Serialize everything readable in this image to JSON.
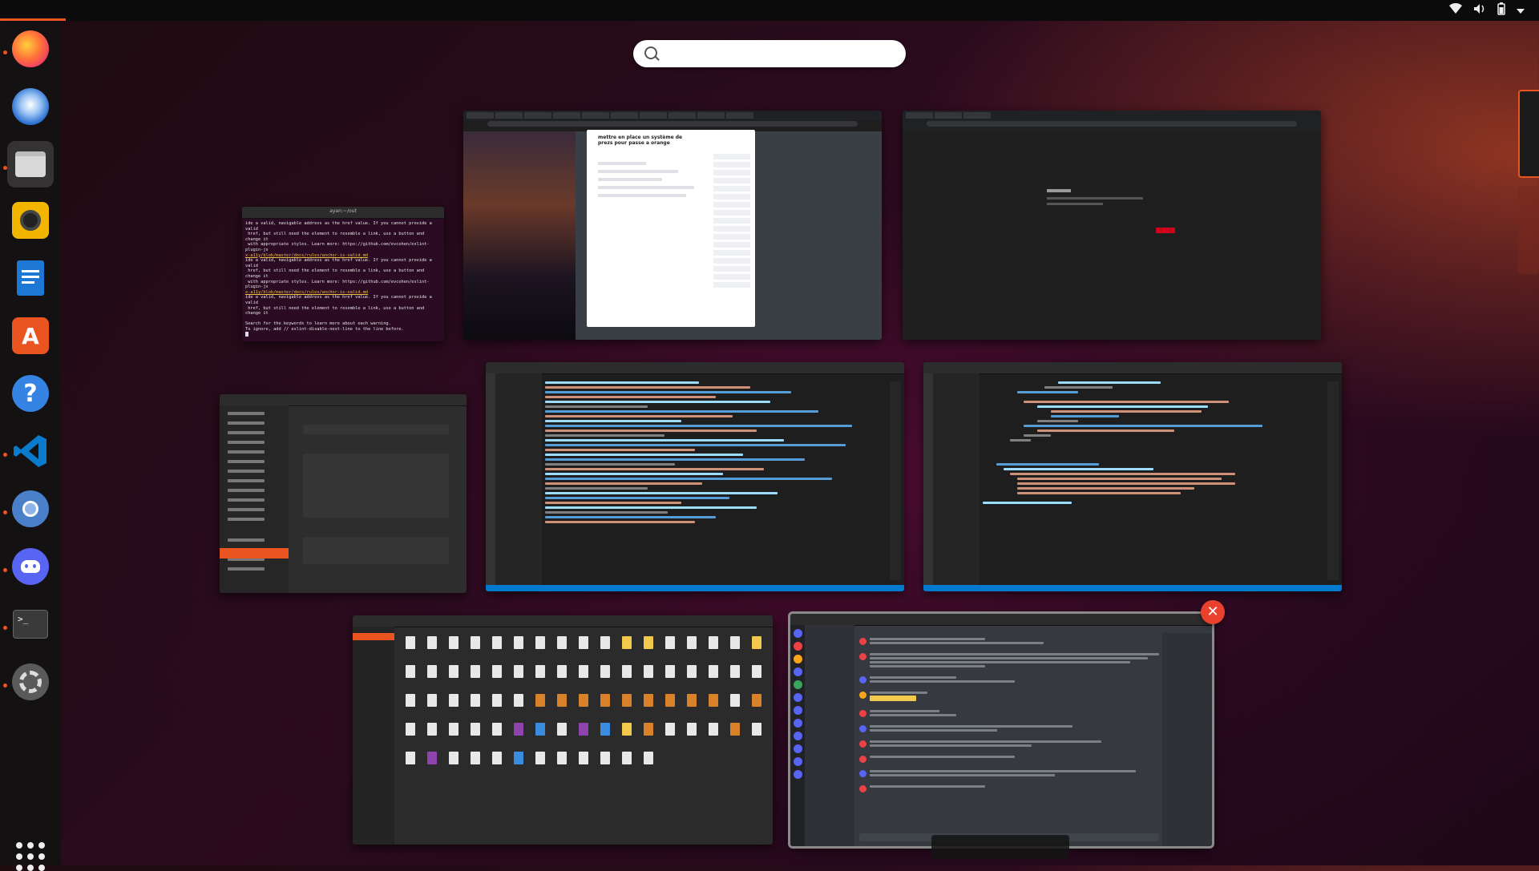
{
  "topbar": {
    "tray_icons": [
      "wifi-icon",
      "volume-icon",
      "battery-icon",
      "menu-arrow-icon"
    ]
  },
  "search": {
    "placeholder": "",
    "value": ""
  },
  "dock": {
    "items": [
      {
        "name": "firefox",
        "color": "#ff7139",
        "running": true
      },
      {
        "name": "thunderbird",
        "color": "#2a6fd0",
        "running": false
      },
      {
        "name": "files",
        "color": "#d9d9d9",
        "running": true
      },
      {
        "name": "rhythmbox",
        "color": "#f2b600",
        "running": false
      },
      {
        "name": "writer",
        "color": "#1c78d4",
        "running": false
      },
      {
        "name": "software",
        "color": "#e95420",
        "running": false
      },
      {
        "name": "help",
        "color": "#3584e4",
        "running": false
      },
      {
        "name": "vscode",
        "color": "#0a7acc",
        "running": true
      },
      {
        "name": "chromium",
        "color": "#4a80c9",
        "running": true
      },
      {
        "name": "discord",
        "color": "#5865f2",
        "running": true
      },
      {
        "name": "terminal",
        "color": "#3a3a3a",
        "running": true
      },
      {
        "name": "settings",
        "color": "#7a7a7a",
        "running": true
      }
    ]
  },
  "windows": {
    "terminal": {
      "title": "ayan:~/out",
      "lines": [
        "ide a valid, navigable address as the href value. If you cannot provide a valid",
        " href, but still need the element to resemble a link, use a button and change it",
        " with appropriate styles. Learn more: https://github.com/evcohen/eslint-plugin-js",
        "x-a11y/blob/master/docs/rules/anchor-is-valid.md"
      ],
      "footer1": "Search for the keywords to learn more about each warning.",
      "footer2": "To ignore, add // eslint-disable-next-line to the line before."
    },
    "browser_modal": {
      "modal_title": "mettre en place un système de prezs pour passe a orange"
    },
    "vscode_a": {},
    "vscode_b": {},
    "discord": {}
  },
  "colors": {
    "accent": "#e95420",
    "close": "#e9412d",
    "vscode_status": "#007acc",
    "discord_bg": "#36393f"
  }
}
